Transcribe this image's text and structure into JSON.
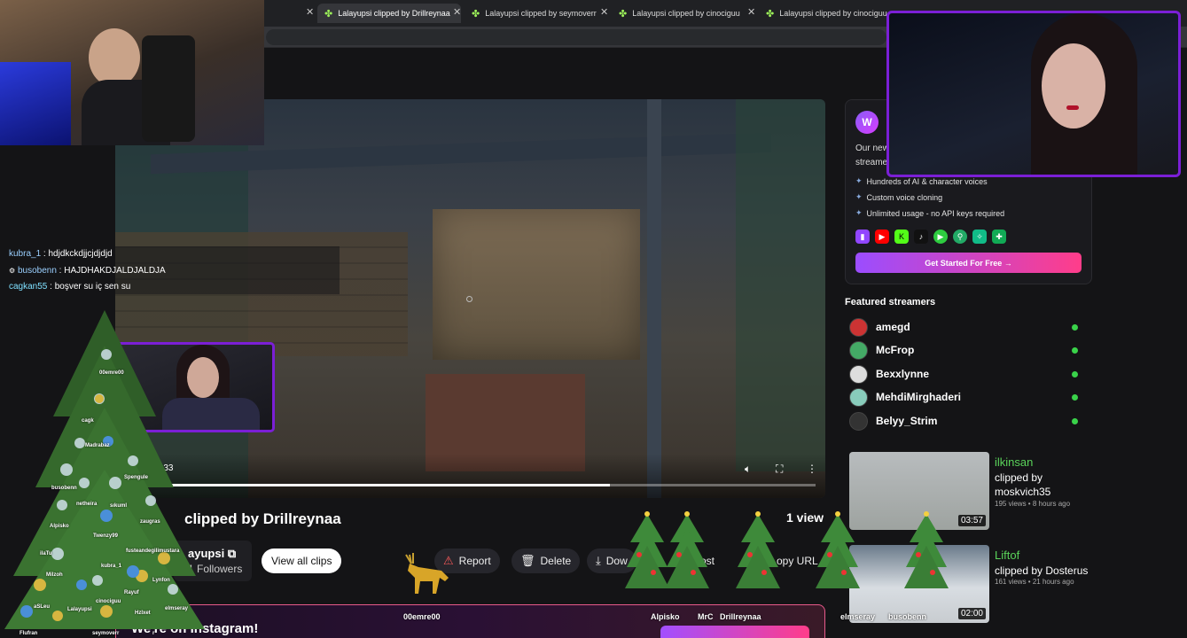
{
  "browser": {
    "tabs": [
      {
        "label": "Lalayupsi clipped by Drillreynaa",
        "active": true
      },
      {
        "label": "Lalayupsi clipped by seymoverr",
        "active": false
      },
      {
        "label": "Lalayupsi clipped by cinociguu",
        "active": false
      },
      {
        "label": "Lalayupsi clipped by cinociguu",
        "active": false
      }
    ]
  },
  "player": {
    "time": "0:33",
    "progress_fraction": 0.69
  },
  "clip": {
    "title": "clipped by Drillreynaa",
    "views": "1 view",
    "channel": "ayupsi",
    "followers": "1 Followers",
    "view_all_label": "View all clips",
    "actions": [
      "Report",
      "Delete",
      "Dow",
      "Post",
      "opy URL"
    ]
  },
  "promo": {
    "description": "Our new streame",
    "features": [
      "Hundreds of AI & character voices",
      "Custom voice cloning",
      "Unlimited usage - no API keys required"
    ],
    "cta_label": "Get Started For Free →"
  },
  "featured": {
    "title": "Featured streamers",
    "streamers": [
      {
        "name": "amegd",
        "live": true
      },
      {
        "name": "McFrop",
        "live": true
      },
      {
        "name": "Bexxlynne",
        "live": true
      },
      {
        "name": "MehdiMirghaderi",
        "live": true
      },
      {
        "name": "Belyy_Strim",
        "live": true
      }
    ]
  },
  "related": [
    {
      "name": "ilkinsan",
      "by": "clipped by moskvich35",
      "meta": "195 views • 8 hours ago",
      "duration": "03:57"
    },
    {
      "name": "Liftof",
      "by": "clipped by Dosterus",
      "meta": "161 views • 21 hours ago",
      "duration": "02:00"
    }
  ],
  "instagram": {
    "text": "We're on Instagram!"
  },
  "chat": [
    {
      "user": "kubra_1",
      "msg": "hdjdkckdjjcjdjdjd"
    },
    {
      "user": "busobenn",
      "msg": "HAJDHAKDJALDJALDJA"
    },
    {
      "user": "cagkan55",
      "msg": "boşver su iç sen su"
    }
  ],
  "tree_labels": [
    "00emre00",
    "cagk",
    "Madrabaz",
    "Spengule",
    "busobenn",
    "netheira",
    "sıkuml",
    "Alpisko",
    "zaugras",
    "Twenzy99",
    "ilaTu",
    "fusteandegilimustara",
    "kubra_1",
    "Milzoh",
    "Lynfon",
    "Rayuf",
    "cinociguu",
    "Lalayupsi",
    "Hzlxet",
    "elmseray",
    "Flufran",
    "seymoverr",
    "aSLeu",
    "r"
  ],
  "bottom_labels": [
    "00emre00",
    "Alpisko",
    "MrC",
    "Drillreynaa",
    "elmseray",
    "busobenn"
  ],
  "colors": {
    "accent_purple": "#7b1fd6",
    "live_green": "#3ad34a",
    "related_name": "#5ad35a"
  }
}
